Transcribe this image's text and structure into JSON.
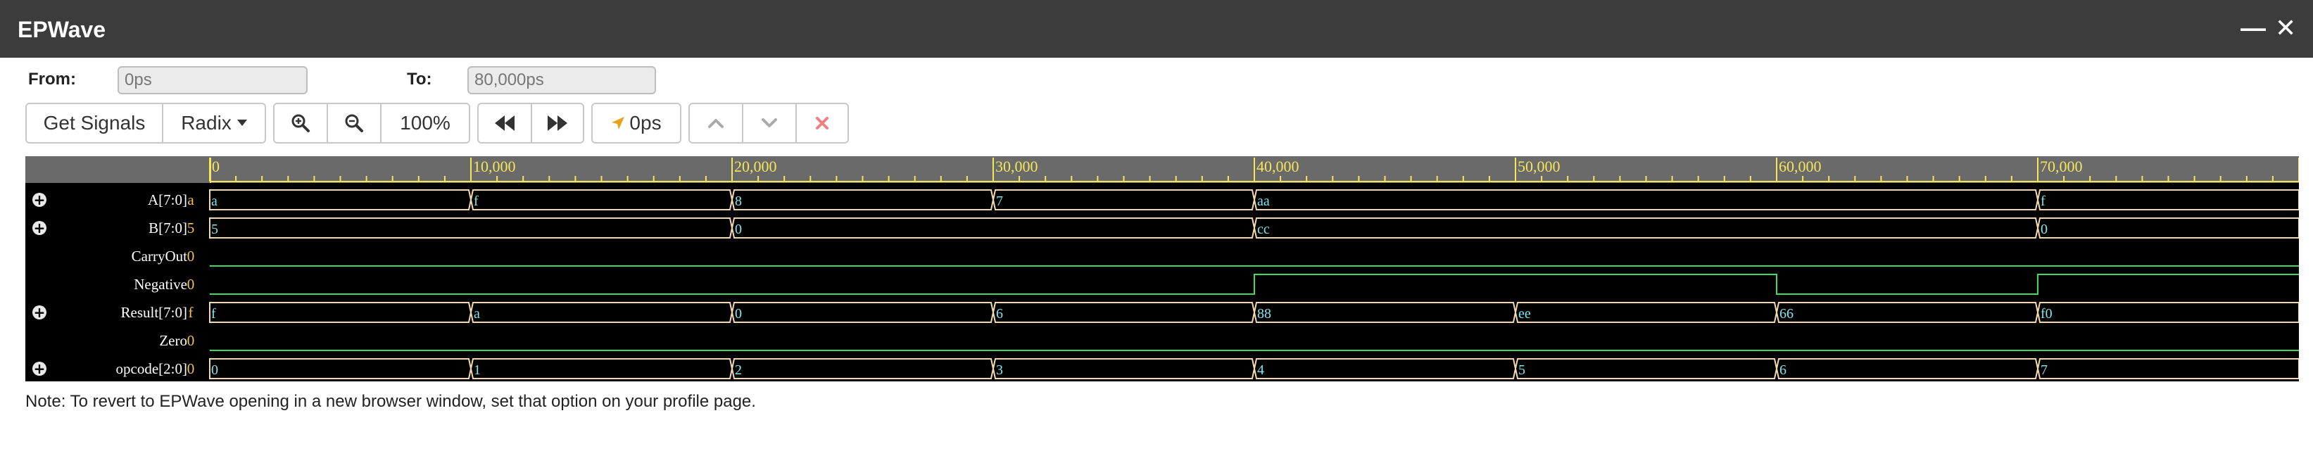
{
  "window": {
    "title": "EPWave",
    "minimize_glyph": "—",
    "close_glyph": "✕"
  },
  "range": {
    "from_label": "From:",
    "from_value": "0ps",
    "to_label": "To:",
    "to_value": "80,000ps"
  },
  "toolbar": {
    "get_signals": "Get Signals",
    "radix": "Radix",
    "zoom_in_icon": "zoom-in-icon",
    "zoom_out_icon": "zoom-out-icon",
    "zoom_level": "100%",
    "rewind_icon": "rewind-icon",
    "fast_forward_icon": "fast-forward-icon",
    "cursor_time": "0ps",
    "up_icon": "chevron-up-icon",
    "down_icon": "chevron-down-icon",
    "delete_icon": "close-icon"
  },
  "waveform": {
    "time_start": 0,
    "time_end": 80000,
    "ruler_labels": [
      "0",
      "10,000",
      "20,000",
      "30,000",
      "40,000",
      "50,000",
      "60,000",
      "70,000"
    ],
    "colors": {
      "ruler_bg": "#6a6a6a",
      "ruler_fg": "#f5e65a",
      "bus": "#f3d9ac",
      "bus_text": "#7fe6ee",
      "bit": "#3ddc5c",
      "bit_high": "#5ad26b",
      "background": "#000000",
      "value": "#f5c44e"
    },
    "signals": [
      {
        "name": "A[7:0]",
        "value": "a",
        "type": "bus",
        "expandable": true,
        "segments": [
          {
            "t": 0,
            "v": "a"
          },
          {
            "t": 10000,
            "v": "f"
          },
          {
            "t": 20000,
            "v": "8"
          },
          {
            "t": 30000,
            "v": "7"
          },
          {
            "t": 40000,
            "v": "aa"
          },
          {
            "t": 70000,
            "v": "f"
          }
        ]
      },
      {
        "name": "B[7:0]",
        "value": "5",
        "type": "bus",
        "expandable": true,
        "segments": [
          {
            "t": 0,
            "v": "5"
          },
          {
            "t": 20000,
            "v": "0"
          },
          {
            "t": 40000,
            "v": "cc"
          },
          {
            "t": 70000,
            "v": "0"
          }
        ]
      },
      {
        "name": "CarryOut",
        "value": "0",
        "type": "bit",
        "expandable": false,
        "segments": [
          {
            "t": 0,
            "v": 0
          }
        ]
      },
      {
        "name": "Negative",
        "value": "0",
        "type": "bit",
        "expandable": false,
        "segments": [
          {
            "t": 0,
            "v": 0
          },
          {
            "t": 40000,
            "v": 1
          },
          {
            "t": 60000,
            "v": 0
          },
          {
            "t": 70000,
            "v": 1
          }
        ]
      },
      {
        "name": "Result[7:0]",
        "value": "f",
        "type": "bus",
        "expandable": true,
        "segments": [
          {
            "t": 0,
            "v": "f"
          },
          {
            "t": 10000,
            "v": "a"
          },
          {
            "t": 20000,
            "v": "0"
          },
          {
            "t": 30000,
            "v": "6"
          },
          {
            "t": 40000,
            "v": "88"
          },
          {
            "t": 50000,
            "v": "ee"
          },
          {
            "t": 60000,
            "v": "66"
          },
          {
            "t": 70000,
            "v": "f0"
          }
        ]
      },
      {
        "name": "Zero",
        "value": "0",
        "type": "bit",
        "expandable": false,
        "segments": [
          {
            "t": 0,
            "v": 0
          }
        ]
      },
      {
        "name": "opcode[2:0]",
        "value": "0",
        "type": "bus",
        "expandable": true,
        "segments": [
          {
            "t": 0,
            "v": "0"
          },
          {
            "t": 10000,
            "v": "1"
          },
          {
            "t": 20000,
            "v": "2"
          },
          {
            "t": 30000,
            "v": "3"
          },
          {
            "t": 40000,
            "v": "4"
          },
          {
            "t": 50000,
            "v": "5"
          },
          {
            "t": 60000,
            "v": "6"
          },
          {
            "t": 70000,
            "v": "7"
          }
        ]
      }
    ]
  },
  "note": "Note: To revert to EPWave opening in a new browser window, set that option on your profile page."
}
